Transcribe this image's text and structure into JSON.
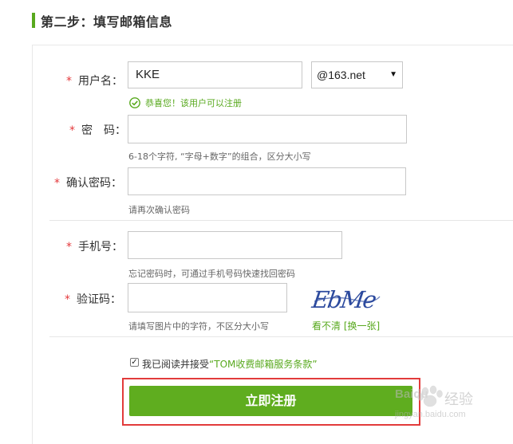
{
  "section": {
    "title": "第二步：填写邮箱信息"
  },
  "form": {
    "username": {
      "label": "用户名：",
      "value": "KKE",
      "success": "恭喜您！该用户可以注册"
    },
    "domain_select": {
      "value": "@163.net"
    },
    "password": {
      "label": "密　码：",
      "value": "",
      "hint": "6-18个字符, “字母+数字”的组合，区分大小写"
    },
    "confirm_password": {
      "label": "确认密码：",
      "value": "",
      "hint": "请再次确认密码"
    },
    "phone": {
      "label": "手机号：",
      "value": "",
      "hint": "忘记密码时，可通过手机号码快速找回密码"
    },
    "captcha": {
      "label": "验证码：",
      "value": "",
      "hint": "请填写图片中的字符，不区分大小写",
      "image_text": "EbMe",
      "refresh_text": "看不清 [换一张]"
    },
    "agreement": {
      "checked": true,
      "prefix": "我已阅读并接受",
      "link": "“TOM收费邮箱服务条款”"
    },
    "submit_label": "立即注册"
  },
  "required_mark": "*",
  "watermark": {
    "brand": "Baidu",
    "text": "经验",
    "url": "jingyan.baidu.com"
  },
  "colors": {
    "accent": "#58a91e",
    "required": "#e4393c",
    "highlight_border": "#e23b3b"
  }
}
